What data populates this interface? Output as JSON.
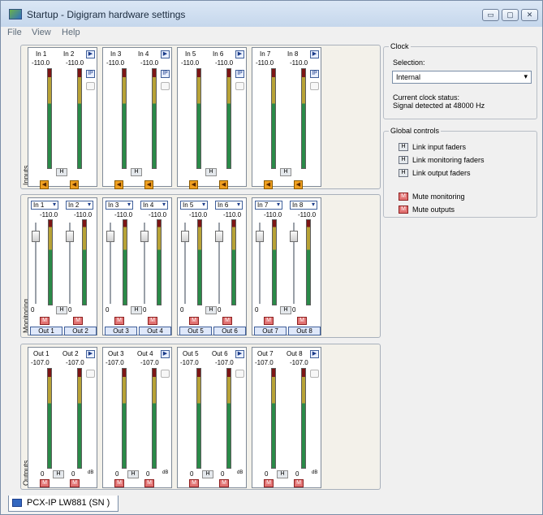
{
  "window": {
    "title": "Startup - Digigram hardware settings",
    "minimize_label": "▭",
    "maximize_label": "▢",
    "close_label": "✕"
  },
  "menu": [
    "File",
    "View",
    "Help"
  ],
  "sections": {
    "inputs": "Inputs",
    "monitoring": "Monitoring",
    "outputs": "Outputs"
  },
  "inputs": {
    "panels": [
      {
        "ch": [
          "In 1",
          "In 2"
        ],
        "levels": [
          "-110.0",
          "-110.0"
        ]
      },
      {
        "ch": [
          "In 3",
          "In 4"
        ],
        "levels": [
          "-110.0",
          "-110.0"
        ]
      },
      {
        "ch": [
          "In 5",
          "In 6"
        ],
        "levels": [
          "-110.0",
          "-110.0"
        ]
      },
      {
        "ch": [
          "In 7",
          "In 8"
        ],
        "levels": [
          "-110.0",
          "-110.0"
        ]
      }
    ],
    "ip_label": "IP",
    "play_label": "▶",
    "link_label": "H",
    "speaker_label": "◀"
  },
  "monitoring": {
    "panels": [
      {
        "sel": [
          "In 1",
          "In 2"
        ],
        "levels": [
          "-110.0",
          "-110.0"
        ],
        "gains": [
          "0",
          "0"
        ],
        "outs": [
          "Out 1",
          "Out 2"
        ]
      },
      {
        "sel": [
          "In 3",
          "In 4"
        ],
        "levels": [
          "-110.0",
          "-110.0"
        ],
        "gains": [
          "0",
          "0"
        ],
        "outs": [
          "Out 3",
          "Out 4"
        ]
      },
      {
        "sel": [
          "In 5",
          "In 6"
        ],
        "levels": [
          "-110.0",
          "-110.0"
        ],
        "gains": [
          "0",
          "0"
        ],
        "outs": [
          "Out 5",
          "Out 6"
        ]
      },
      {
        "sel": [
          "In 7",
          "In 8"
        ],
        "levels": [
          "-110.0",
          "-110.0"
        ],
        "gains": [
          "0",
          "0"
        ],
        "outs": [
          "Out 7",
          "Out 8"
        ]
      }
    ],
    "mute_label": "M",
    "link_label": "H"
  },
  "outputs": {
    "panels": [
      {
        "ch": [
          "Out 1",
          "Out 2"
        ],
        "levels": [
          "-107.0",
          "-107.0"
        ],
        "gains": [
          "0",
          "0"
        ]
      },
      {
        "ch": [
          "Out 3",
          "Out 4"
        ],
        "levels": [
          "-107.0",
          "-107.0"
        ],
        "gains": [
          "0",
          "0"
        ]
      },
      {
        "ch": [
          "Out 5",
          "Out 6"
        ],
        "levels": [
          "-107.0",
          "-107.0"
        ],
        "gains": [
          "0",
          "0"
        ]
      },
      {
        "ch": [
          "Out 7",
          "Out 8"
        ],
        "levels": [
          "-107.0",
          "-107.0"
        ],
        "gains": [
          "0",
          "0"
        ]
      }
    ],
    "db_label": "dB",
    "mute_label": "M",
    "link_label": "H",
    "play_label": "▶"
  },
  "clock": {
    "group_label": "Clock",
    "selection_label": "Selection:",
    "selection_value": "Internal",
    "status_label": "Current clock status:",
    "status_value": "Signal detected at 48000 Hz"
  },
  "global_controls": {
    "group_label": "Global controls",
    "link_input": "Link input faders",
    "link_monitoring": "Link monitoring faders",
    "link_output": "Link output faders",
    "mute_monitoring": "Mute monitoring",
    "mute_outputs": "Mute outputs",
    "link_glyph": "H",
    "mute_glyph": "M"
  },
  "tab": {
    "label": "PCX-IP LW881 (SN )"
  }
}
